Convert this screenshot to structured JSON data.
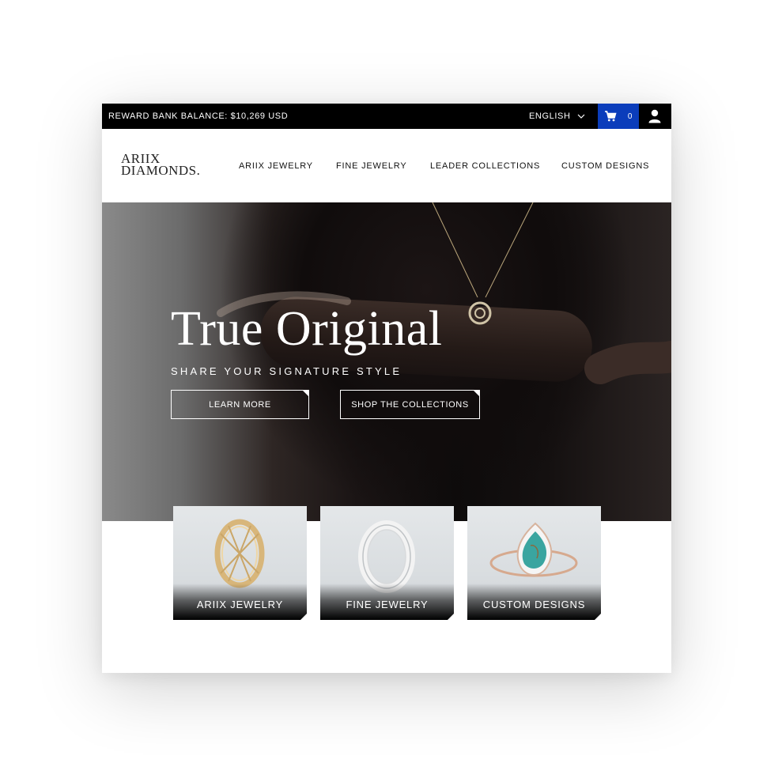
{
  "topbar": {
    "reward_label": "REWARD BANK BALANCE:",
    "reward_value": "$10,269 USD",
    "language": "ENGLISH",
    "cart_count": "0"
  },
  "header": {
    "logo_line1": "ARIIX",
    "logo_line2": "DIAMONDS.",
    "nav": [
      "ARIIX JEWELRY",
      "FINE JEWELRY",
      "LEADER COLLECTIONS",
      "CUSTOM DESIGNS"
    ]
  },
  "hero": {
    "title": "True Original",
    "subtitle": "SHARE YOUR SIGNATURE STYLE",
    "btn_learn": "LEARN MORE",
    "btn_shop": "SHOP THE COLLECTIONS"
  },
  "cards": [
    {
      "label": "ARIIX JEWELRY"
    },
    {
      "label": "FINE JEWELRY"
    },
    {
      "label": "CUSTOM DESIGNS"
    }
  ],
  "colors": {
    "cart_bg": "#0b3dbb",
    "topbar_bg": "#000000"
  },
  "icons": [
    "chevron-down-icon",
    "cart-icon",
    "user-icon"
  ]
}
